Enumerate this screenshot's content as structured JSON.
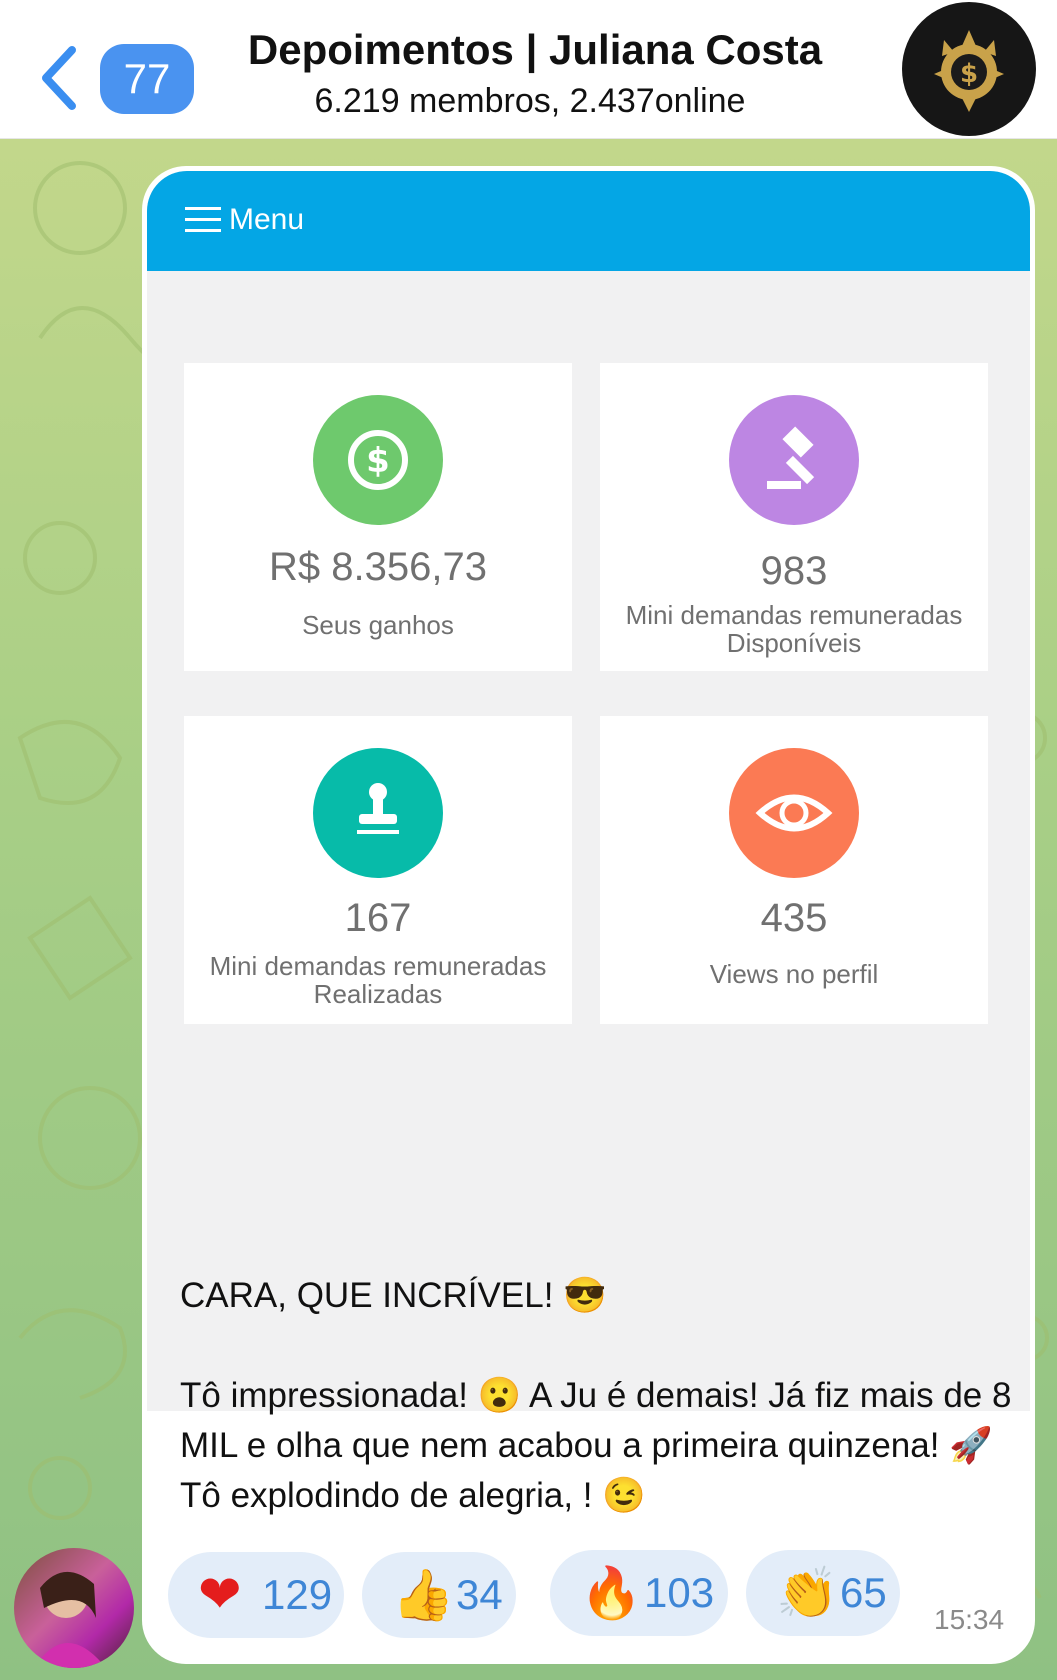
{
  "header": {
    "back_count": "77",
    "title": "Depoimentos | Juliana Costa",
    "subtitle": "6.219 membros, 2.437online",
    "avatar_icon": "dollar-gear-icon"
  },
  "screenshot": {
    "menu_label": "Menu",
    "cards": [
      {
        "icon": "dollar-circle-icon",
        "color": "#6ec96d",
        "value": "R$ 8.356,73",
        "label": "Seus ganhos"
      },
      {
        "icon": "gavel-icon",
        "color": "#bd86e3",
        "value": "983",
        "label": "Mini demandas remuneradas Disponíveis"
      },
      {
        "icon": "stamp-icon",
        "color": "#07bba9",
        "value": "167",
        "label": "Mini demandas remuneradas Realizadas"
      },
      {
        "icon": "eye-icon",
        "color": "#fb7a54",
        "value": "435",
        "label": "Views no perfil"
      }
    ]
  },
  "message": {
    "line1": "CARA, QUE INCRÍVEL! 😎",
    "line2": "Tô impressionada! 😮 A Ju é demais! Já fiz mais de 8 MIL e olha que nem acabou a primeira quinzena! 🚀 Tô explodindo de alegria, ! 😉",
    "time": "15:34"
  },
  "reactions": [
    {
      "emoji": "❤️",
      "icon": "red-heart-icon",
      "count": "129"
    },
    {
      "emoji": "👍",
      "icon": "thumbs-up-icon",
      "count": "34"
    },
    {
      "emoji": "🔥",
      "icon": "fire-icon",
      "count": "103"
    },
    {
      "emoji": "👏",
      "icon": "clapping-hands-icon",
      "count": "65"
    }
  ]
}
